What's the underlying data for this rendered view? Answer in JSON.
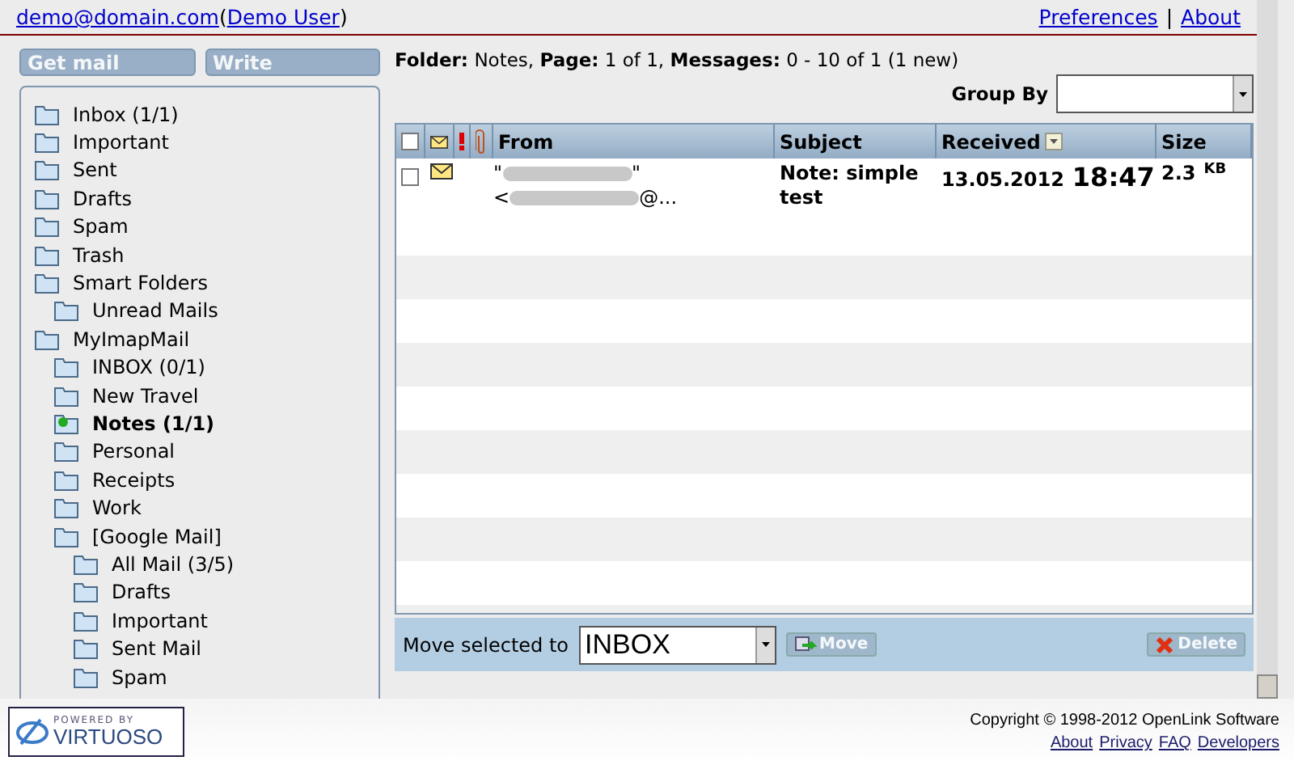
{
  "top_bar": {
    "email": "demo@domain.com",
    "open": "(",
    "user": "Demo User",
    "close": ")",
    "separator": "|",
    "links": [
      "Preferences",
      "About"
    ]
  },
  "buttons": [
    "Get mail",
    "Write"
  ],
  "folders": [
    {
      "label": "Inbox (1/1)",
      "kind": "folder",
      "selected": false
    },
    {
      "label": "Important",
      "kind": "folder",
      "selected": false
    },
    {
      "label": "Sent",
      "kind": "folder",
      "selected": false
    },
    {
      "label": "Drafts",
      "kind": "folder",
      "selected": false
    },
    {
      "label": "Spam",
      "kind": "folder",
      "selected": false
    },
    {
      "label": "Trash",
      "kind": "folder",
      "selected": false
    },
    {
      "label": "Smart Folders",
      "kind": "folder",
      "selected": false,
      "children": [
        {
          "label": "Unread Mails",
          "kind": "folder",
          "selected": false
        }
      ]
    },
    {
      "label": "MyImapMail",
      "kind": "folder",
      "selected": false,
      "children": [
        {
          "label": "INBOX (0/1)",
          "kind": "folder",
          "selected": false
        },
        {
          "label": "New Travel",
          "kind": "folder",
          "selected": false
        },
        {
          "label": "Notes (1/1)",
          "kind": "new",
          "selected": true
        },
        {
          "label": "Personal",
          "kind": "folder",
          "selected": false
        },
        {
          "label": "Receipts",
          "kind": "folder",
          "selected": false
        },
        {
          "label": "Work",
          "kind": "folder",
          "selected": false
        },
        {
          "label": "[Google Mail]",
          "kind": "folder",
          "selected": false,
          "children": [
            {
              "label": "All Mail (3/5)",
              "kind": "folder",
              "selected": false
            },
            {
              "label": "Drafts",
              "kind": "folder",
              "selected": false
            },
            {
              "label": "Important",
              "kind": "folder",
              "selected": false
            },
            {
              "label": "Sent Mail",
              "kind": "folder",
              "selected": false
            },
            {
              "label": "Spam",
              "kind": "folder",
              "selected": false
            }
          ]
        }
      ]
    }
  ],
  "info": [
    {
      "key": "Folder:",
      "value": "Notes,"
    },
    {
      "key": "Page:",
      "value": "1 of 1,"
    },
    {
      "key": "Messages:",
      "value": "0 - 10 of 1 (1 new)"
    }
  ],
  "group_by": {
    "label": "Group By"
  },
  "table": {
    "select_all": false,
    "columns": [
      "From",
      "Subject",
      "Received",
      "Size"
    ],
    "rows": [
      {
        "checked": false,
        "from": [
          {
            "before": "\"",
            "after": "\""
          },
          {
            "before": "<",
            "after": "@..."
          }
        ],
        "subject": "Note: simple test",
        "date": "13.05.2012",
        "time": "18:47",
        "size": "2.3",
        "unit": "KB"
      }
    ]
  },
  "move_bar": {
    "label": "Move selected to",
    "target": "INBOX",
    "move": "Move",
    "delete": "Delete"
  },
  "footer": {
    "copyright": "Copyright © 1998-2012 OpenLink Software",
    "links": [
      "About",
      "Privacy",
      "FAQ",
      "Developers"
    ],
    "logo_top": "POWERED BY",
    "logo_name": "VIRTUOSO"
  }
}
